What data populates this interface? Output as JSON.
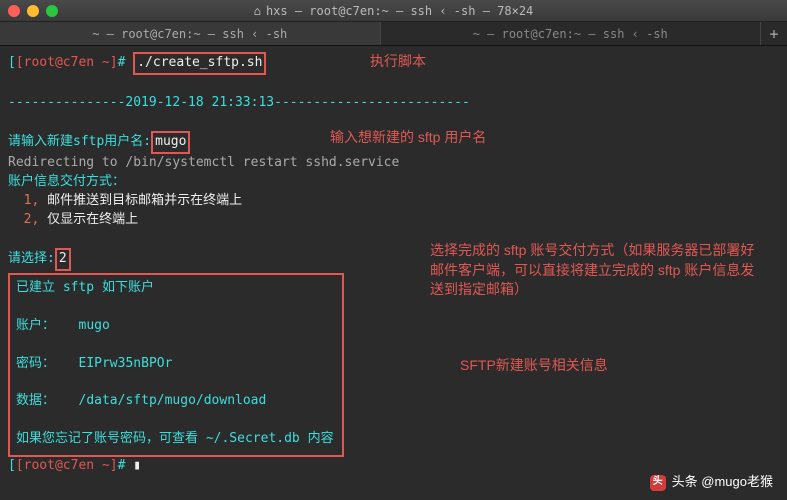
{
  "titlebar": {
    "title": "hxs — root@c7en:~ — ssh ‹ -sh — 78×24",
    "home_icon": "⌂"
  },
  "tabs": [
    {
      "label": "~ — root@c7en:~ — ssh ‹ -sh"
    },
    {
      "label": "~ — root@c7en:~ — ssh ‹ -sh"
    }
  ],
  "newtab": "+",
  "prompt": {
    "open": "[",
    "user": "[root@c7en ~]",
    "hash": "# ",
    "close": "]"
  },
  "lines": {
    "cmd": "./create_sftp.sh",
    "timestamp_pre": "---------------",
    "timestamp": "2019-12-18 21:33:13",
    "timestamp_post": "-------------------------",
    "prompt_user_label": "请输入新建sftp用户名:",
    "username": "mugo",
    "redirect": "Redirecting to /bin/systemctl restart sshd.service",
    "delivery_head": "账户信息交付方式：",
    "opt1_num": "1,",
    "opt1_txt": " 邮件推送到目标邮箱并示在终端上",
    "opt2_num": "2,",
    "opt2_txt": " 仅显示在终端上",
    "select_label": "请选择:",
    "select_val": "2",
    "acct_head": "已建立 sftp 如下账户",
    "acct_user_k": "账户：",
    "acct_user_v": "mugo",
    "acct_pwd_k": "密码：",
    "acct_pwd_v": "EIPrw35nBPOr",
    "acct_data_k": "数据：",
    "acct_data_v": "/data/sftp/mugo/download",
    "forgot": "如果您忘记了账号密码，可查看 ~/.Secret.db 内容"
  },
  "annotations": {
    "a1": "执行脚本",
    "a2": "输入想新建的 sftp 用户名",
    "a3": "选择完成的 sftp 账号交付方式（如果服务器已部署好邮件客户端，可以直接将建立完成的 sftp 账户信息发送到指定邮箱）",
    "a4": "SFTP新建账号相关信息"
  },
  "watermark": "头条 @mugo老猴"
}
